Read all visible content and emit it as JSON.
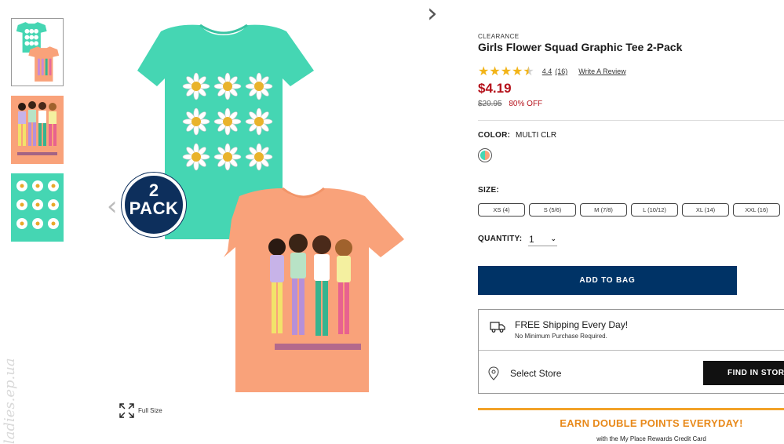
{
  "gallery": {
    "thumbnails": [
      "thumb-1",
      "thumb-2",
      "thumb-3"
    ],
    "badge_number": "2",
    "badge_text": "PACK",
    "prev_arrow": "‹",
    "next_arrow": "›",
    "full_size_label": "Full Size",
    "watermark": "ladies.ep.ua"
  },
  "product": {
    "tag": "CLEARANCE",
    "title": "Girls Flower Squad Graphic Tee 2-Pack",
    "rating": 4.4,
    "rating_text": "4.4",
    "review_count": "(16)",
    "write_review": "Write A Review",
    "price": "$4.19",
    "original_price": "$20.95",
    "discount": "80% OFF",
    "color_label": "COLOR:",
    "color_value": "MULTI CLR",
    "size_label": "SIZE:",
    "sizes": [
      "XS (4)",
      "S (5/6)",
      "M (7/8)",
      "L (10/12)",
      "XL (14)",
      "XXL (16)"
    ],
    "quantity_label": "QUANTITY:",
    "quantity_value": "1",
    "add_to_bag": "ADD TO BAG"
  },
  "shipping": {
    "title": "FREE Shipping Every Day!",
    "subtitle": "No Minimum Purchase Required.",
    "select_store": "Select Store",
    "find_store": "FIND IN STORE"
  },
  "promo": {
    "title": "EARN DOUBLE POINTS EVERYDAY!",
    "subtitle": "with the My Place Rewards Credit Card"
  },
  "colors": {
    "price_red": "#b5121b",
    "navy": "#003366",
    "star_gold": "#f2b418",
    "promo_orange": "#e8891a",
    "tee_mint": "#45d6b3",
    "tee_peach": "#f9a27a"
  }
}
